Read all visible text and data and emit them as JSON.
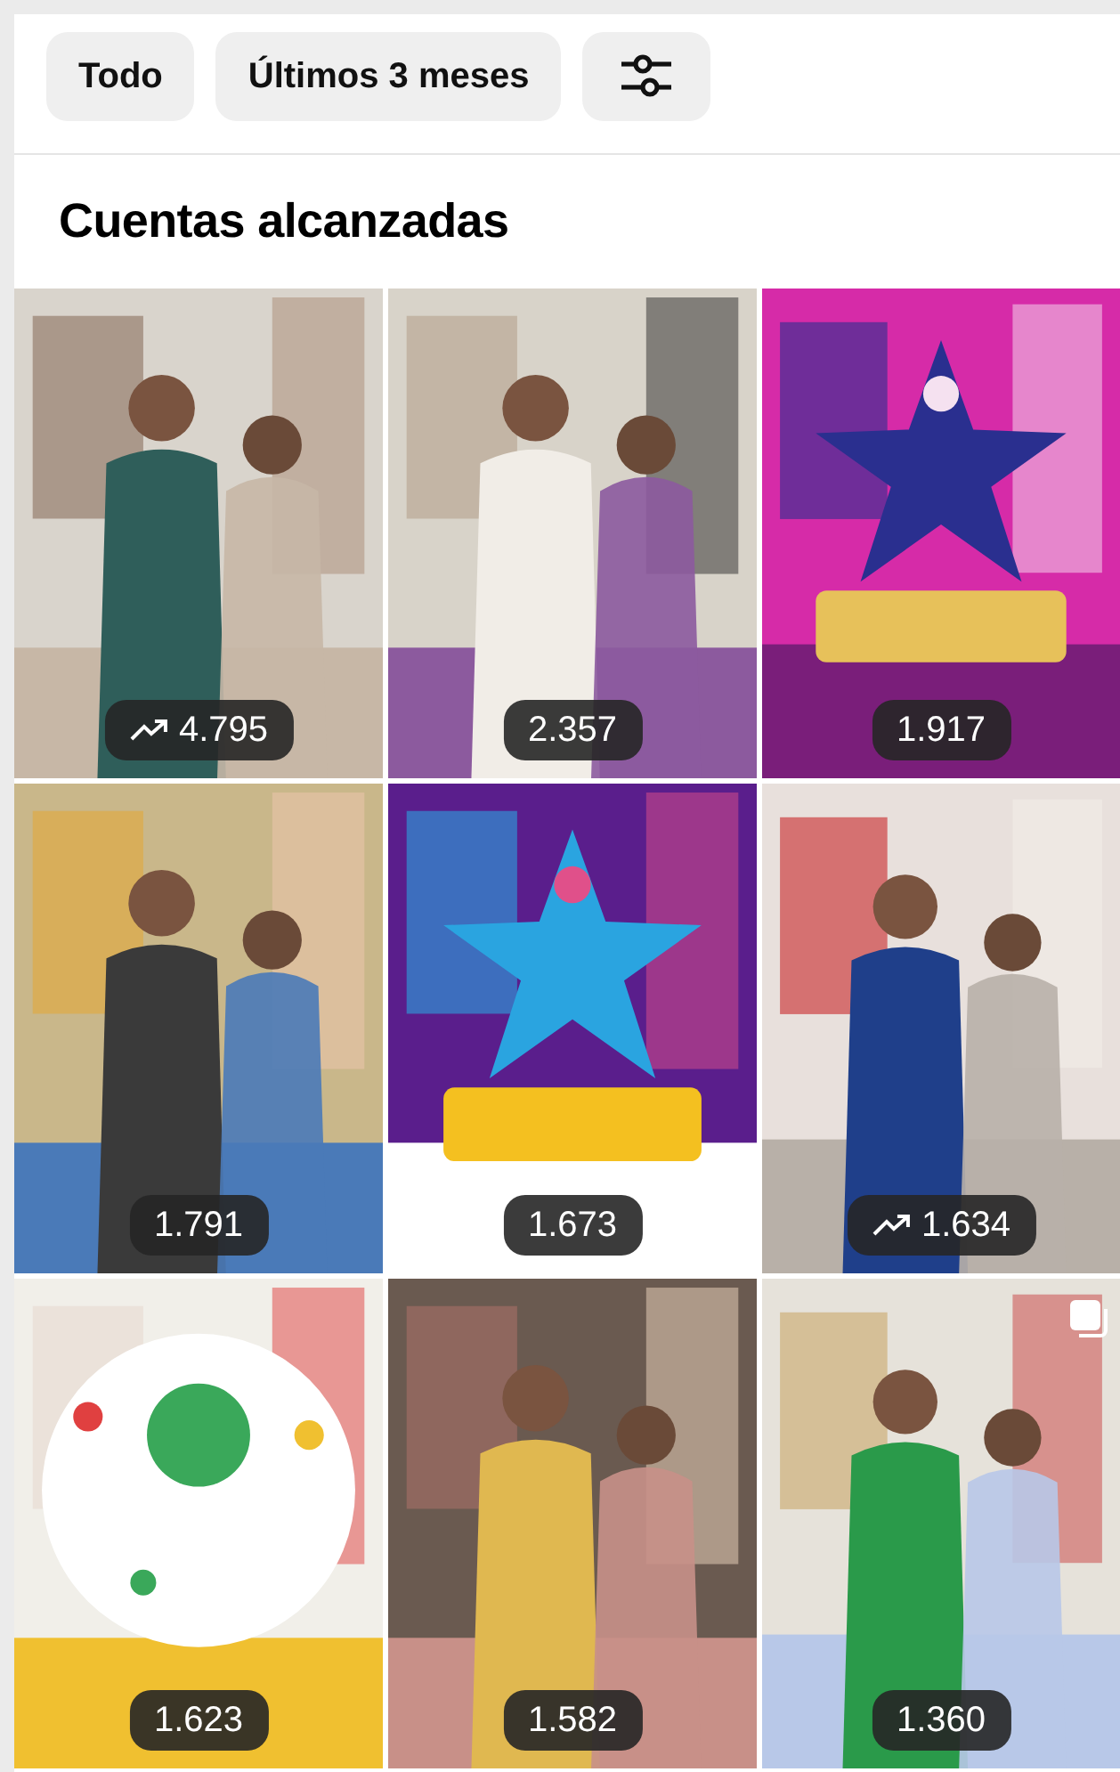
{
  "filters": [
    {
      "kind": "text",
      "label": "Todo"
    },
    {
      "kind": "text",
      "label": "Últimos 3 meses"
    },
    {
      "kind": "icon"
    }
  ],
  "section_title": "Cuentas alcanzadas",
  "posts": [
    {
      "kind": "picture",
      "count": "4.795",
      "trending": true,
      "carousel": false
    },
    {
      "kind": "picture",
      "count": "2.357",
      "trending": false,
      "carousel": false
    },
    {
      "kind": "picture",
      "count": "1.917",
      "trending": false,
      "carousel": false
    },
    {
      "kind": "picture",
      "count": "1.791",
      "trending": false,
      "carousel": false
    },
    {
      "kind": "picture",
      "count": "1.673",
      "trending": false,
      "carousel": false
    },
    {
      "kind": "picture",
      "count": "1.634",
      "trending": true,
      "carousel": false
    },
    {
      "kind": "picture",
      "count": "1.623",
      "trending": false,
      "carousel": false
    },
    {
      "kind": "picture",
      "count": "1.582",
      "trending": false,
      "carousel": false
    },
    {
      "kind": "picture",
      "count": "1.360",
      "trending": false,
      "carousel": true
    }
  ]
}
